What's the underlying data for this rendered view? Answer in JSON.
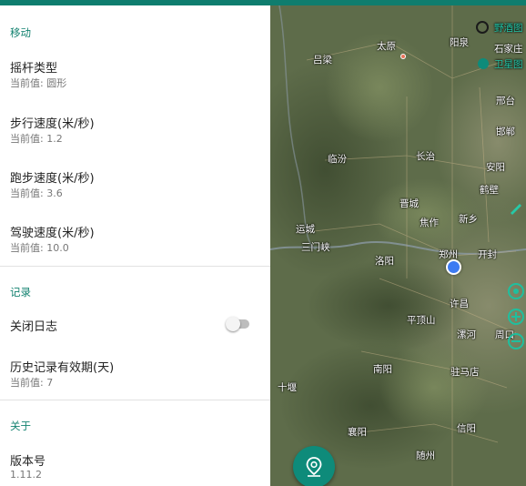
{
  "settings": {
    "move_header": "移动",
    "joystick_type": {
      "title": "摇杆类型",
      "sub": "当前值: 圆形"
    },
    "walk_speed": {
      "title": "步行速度(米/秒)",
      "sub": "当前值: 1.2"
    },
    "run_speed": {
      "title": "跑步速度(米/秒)",
      "sub": "当前值: 3.6"
    },
    "drive_speed": {
      "title": "驾驶速度(米/秒)",
      "sub": "当前值: 10.0"
    },
    "record_header": "记录",
    "close_log": {
      "title": "关闭日志",
      "enabled": false
    },
    "history_validity": {
      "title": "历史记录有效期(天)",
      "sub": "当前值: 7"
    },
    "about_header": "关于",
    "version": {
      "title": "版本号",
      "sub": "1.11.2"
    }
  },
  "map": {
    "cities": {
      "taiyuan": "太原",
      "yangquan": "阳泉",
      "shijiazhuang": "石家庄",
      "lvliang": "吕梁",
      "xingtai": "邢台",
      "handan": "邯郸",
      "linfen": "临汾",
      "changzhi": "长治",
      "anyang": "安阳",
      "hebi": "鹤壁",
      "jincheng": "晋城",
      "jiaozuo": "焦作",
      "xinxiang": "新乡",
      "yuncheng": "运城",
      "sanmenxia": "三门峡",
      "zhengzhou": "郑州",
      "kaifeng": "开封",
      "luoyang": "洛阳",
      "xuchang": "许昌",
      "pingdingshan": "平顶山",
      "luohe": "漯河",
      "zhoukou": "周口",
      "nanyang": "南阳",
      "zhumadian": "驻马店",
      "shiyan": "十堰",
      "xiangyang": "襄阳",
      "xinyang": "信阳",
      "suizhou": "随州"
    },
    "top_right_labels": {
      "wild_map": "野酒图",
      "satellite": "卫星图"
    },
    "colors": {
      "accent": "#0e8b7a",
      "location_dot": "#3d7bf2"
    }
  }
}
